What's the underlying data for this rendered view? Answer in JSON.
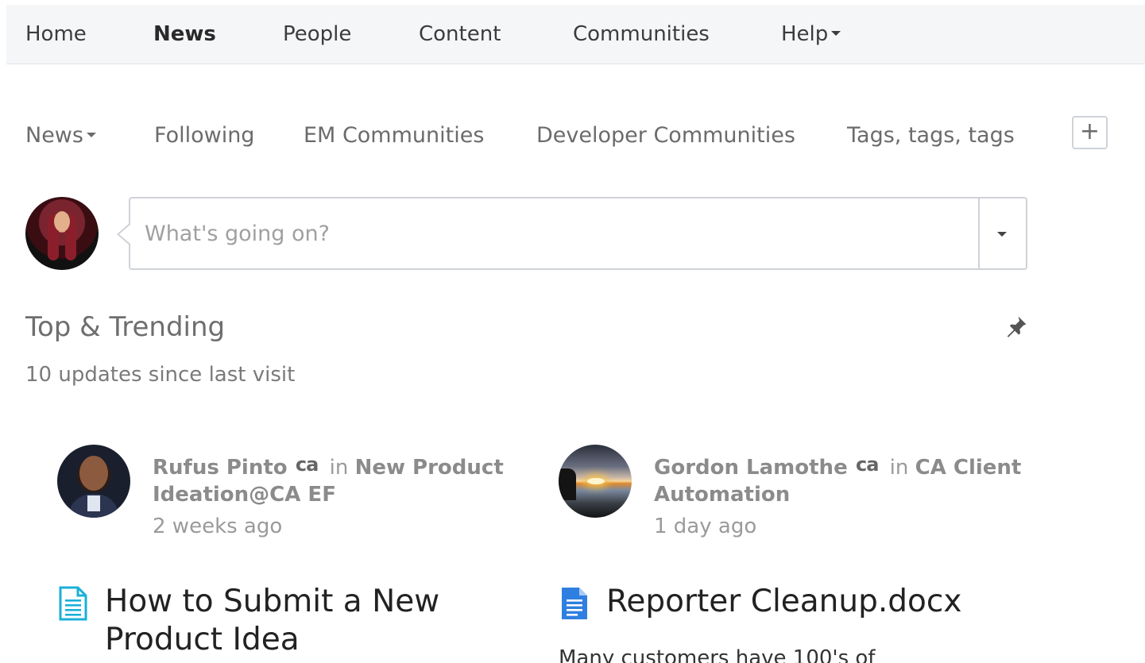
{
  "topnav": {
    "items": [
      {
        "label": "Home"
      },
      {
        "label": "News"
      },
      {
        "label": "People"
      },
      {
        "label": "Content"
      },
      {
        "label": "Communities"
      },
      {
        "label": "Help"
      }
    ],
    "active": "News"
  },
  "subnav": {
    "items": [
      {
        "label": "News"
      },
      {
        "label": "Following"
      },
      {
        "label": "EM Communities"
      },
      {
        "label": "Developer Communities"
      },
      {
        "label": "Tags, tags, tags"
      }
    ],
    "add_label": "+"
  },
  "composer": {
    "placeholder": "What's going on?",
    "value": ""
  },
  "section": {
    "title": "Top & Trending",
    "subtitle": "10 updates since last visit"
  },
  "cards": [
    {
      "author": "Rufus Pinto",
      "badge": "ca",
      "in_word": "in",
      "place": "New Product Ideation@CA EF",
      "time": "2 weeks ago",
      "icon": "document-text-icon",
      "icon_color": "#1ab0d8",
      "title": "How to Submit a New Product Idea",
      "excerpt": ""
    },
    {
      "author": "Gordon Lamothe",
      "badge": "ca",
      "in_word": "in",
      "place": "CA Client Automation",
      "time": "1 day ago",
      "icon": "word-document-icon",
      "icon_color": "#2f7fe0",
      "title": "Reporter Cleanup.docx",
      "excerpt": "Many customers have 100's of"
    }
  ]
}
